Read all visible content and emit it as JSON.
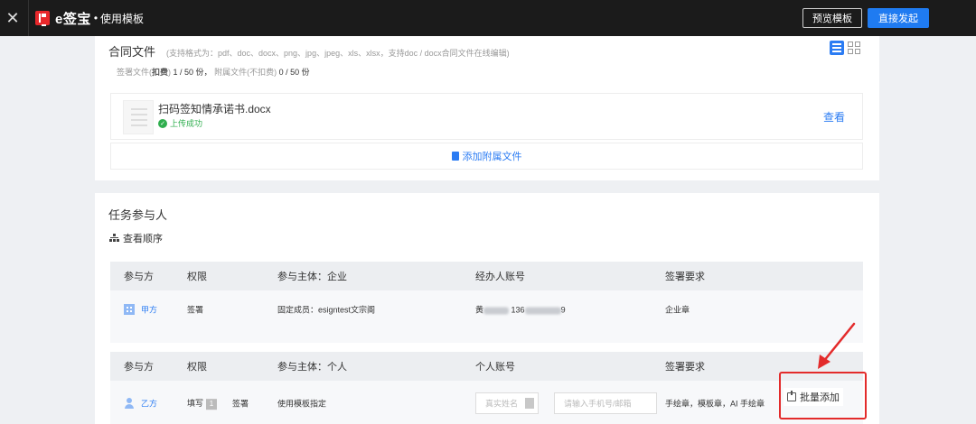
{
  "topbar": {
    "logo_text": "e签宝",
    "logo_dot": "•",
    "page_title": "使用模板",
    "preview_label": "预览模板",
    "launch_label": "直接发起"
  },
  "contract": {
    "title": "合同文件",
    "format_hint": "(支持格式为：pdf、doc、docx、png、jpg、jpeg、xls、xlsx，支持doc / docx合同文件在线编辑)",
    "sign_files_label": "签署文件(",
    "sign_files_deduct": "扣费",
    "sign_files_close": ")",
    "sign_files_count": "1 / 50 份，",
    "attach_files_label": "附属文件(不扣费)",
    "attach_files_count": "0 / 50 份",
    "file": {
      "name": "扫码签知情承诺书.docx",
      "status": "上传成功",
      "view_label": "查看"
    },
    "add_attach_label": "添加附属文件"
  },
  "participants": {
    "title": "任务参与人",
    "order_label": "查看顺序",
    "enterprise_table": {
      "headers": [
        "参与方",
        "权限",
        "参与主体：企业",
        "经办人账号",
        "签署要求"
      ],
      "row": {
        "party": "甲方",
        "permission": "签署",
        "subject": "固定成员：esigntest文宗阁",
        "account_prefix": "黄",
        "account_mid": "136",
        "account_suffix": "9",
        "requirement": "企业章"
      }
    },
    "personal_table": {
      "headers": [
        "参与方",
        "权限",
        "参与主体：个人",
        "个人账号",
        "签署要求"
      ],
      "row": {
        "party": "乙方",
        "permission_fill": "填写",
        "fill_badge": "1",
        "permission_sign": "签署",
        "subject": "使用模板指定",
        "name_placeholder": "真实姓名",
        "phone_placeholder": "请输入手机号/邮箱",
        "requirement": "手绘章，模板章，AI 手绘章"
      },
      "batch_add_label": "批量添加"
    }
  },
  "colors": {
    "accent": "#2b7cf3",
    "primary_button": "#1f7bf1",
    "success": "#2fae4e",
    "annotation": "#e32b2b",
    "brand": "#e8282b"
  }
}
